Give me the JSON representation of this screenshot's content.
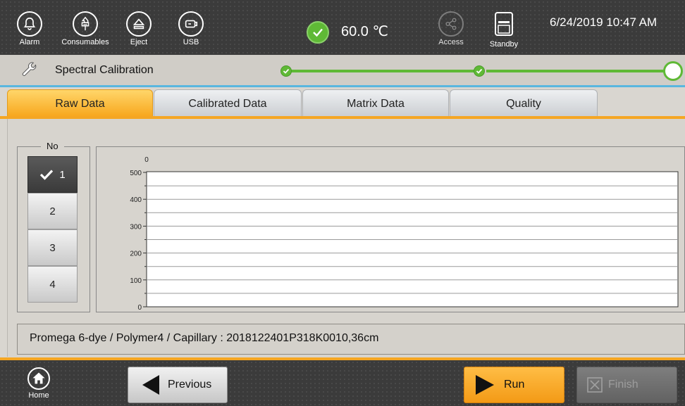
{
  "topbar": {
    "buttons": [
      {
        "label": "Alarm",
        "icon": "bell-icon"
      },
      {
        "label": "Consumables",
        "icon": "consumables-icon"
      },
      {
        "label": "Eject",
        "icon": "eject-icon"
      },
      {
        "label": "USB",
        "icon": "usb-icon"
      }
    ],
    "temperature": "60.0 ℃",
    "access_label": "Access",
    "standby_label": "Standby",
    "datetime": "6/24/2019 10:47 AM"
  },
  "workflow": {
    "title": "Spectral Calibration",
    "steps_completed": 2,
    "steps_total": 3
  },
  "tabs": [
    {
      "label": "Raw Data",
      "active": true
    },
    {
      "label": "Calibrated Data",
      "active": false
    },
    {
      "label": "Matrix Data",
      "active": false
    },
    {
      "label": "Quality",
      "active": false
    }
  ],
  "capillary_group": {
    "legend": "No",
    "items": [
      "1",
      "2",
      "3",
      "4"
    ],
    "selected": "1"
  },
  "chart_data": {
    "type": "line",
    "series": [],
    "x_tick_labels": [
      "0"
    ],
    "y_tick_labels": [
      "0",
      "100",
      "200",
      "300",
      "400",
      "500"
    ],
    "ylim": [
      0,
      500
    ],
    "grid": true
  },
  "info_text": "Promega 6-dye / Polymer4 /  Capillary : 2018122401P318K0010,36cm",
  "bottombar": {
    "home_label": "Home",
    "previous_label": "Previous",
    "run_label": "Run",
    "finish_label": "Finish"
  },
  "colors": {
    "accent_orange": "#f5a623",
    "progress_green": "#5fb936",
    "bar_dark": "#3b3b3b"
  }
}
